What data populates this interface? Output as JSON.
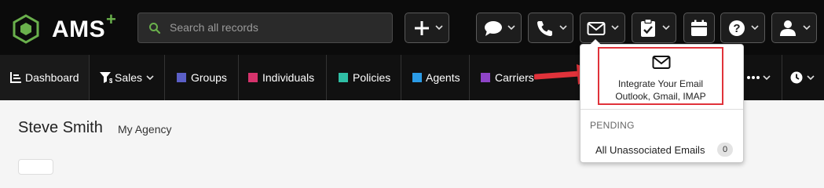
{
  "logo": {
    "text": "AMS",
    "plus": "+",
    "icon": "hexagon-logo-icon"
  },
  "search": {
    "placeholder": "Search all records",
    "icon": "search-icon"
  },
  "toolbar": {
    "buttons": [
      {
        "name": "add",
        "icon": "plus-icon"
      },
      {
        "name": "chat",
        "icon": "chat-bubble-icon"
      },
      {
        "name": "phone",
        "icon": "phone-icon"
      },
      {
        "name": "email",
        "icon": "envelope-icon"
      },
      {
        "name": "tasks",
        "icon": "clipboard-check-icon"
      },
      {
        "name": "calendar",
        "icon": "calendar-icon"
      },
      {
        "name": "help",
        "icon": "question-icon"
      },
      {
        "name": "user",
        "icon": "user-icon"
      }
    ]
  },
  "nav": {
    "items": [
      {
        "label": "Dashboard",
        "icon": "dashboard-icon"
      },
      {
        "label": "Sales",
        "icon": "sales-filter-icon"
      },
      {
        "label": "Groups",
        "color": "#5b5fc7"
      },
      {
        "label": "Individuals",
        "color": "#d6336c"
      },
      {
        "label": "Policies",
        "color": "#2fbfa5"
      },
      {
        "label": "Agents",
        "color": "#2b9be6"
      },
      {
        "label": "Carriers",
        "color": "#8e44c7"
      }
    ],
    "more_icon": "ellipsis-icon",
    "history_icon": "clock-icon"
  },
  "profile": {
    "name": "Steve Smith",
    "agency": "My Agency"
  },
  "email_dropdown": {
    "integrate_line1": "Integrate Your Email",
    "integrate_line2": "Outlook, Gmail, IMAP",
    "pending_label": "PENDING",
    "unassociated_label": "All Unassociated Emails",
    "unassociated_count": "0"
  },
  "colors": {
    "accent_green": "#6ab04c",
    "highlight_red": "#e0323a"
  }
}
